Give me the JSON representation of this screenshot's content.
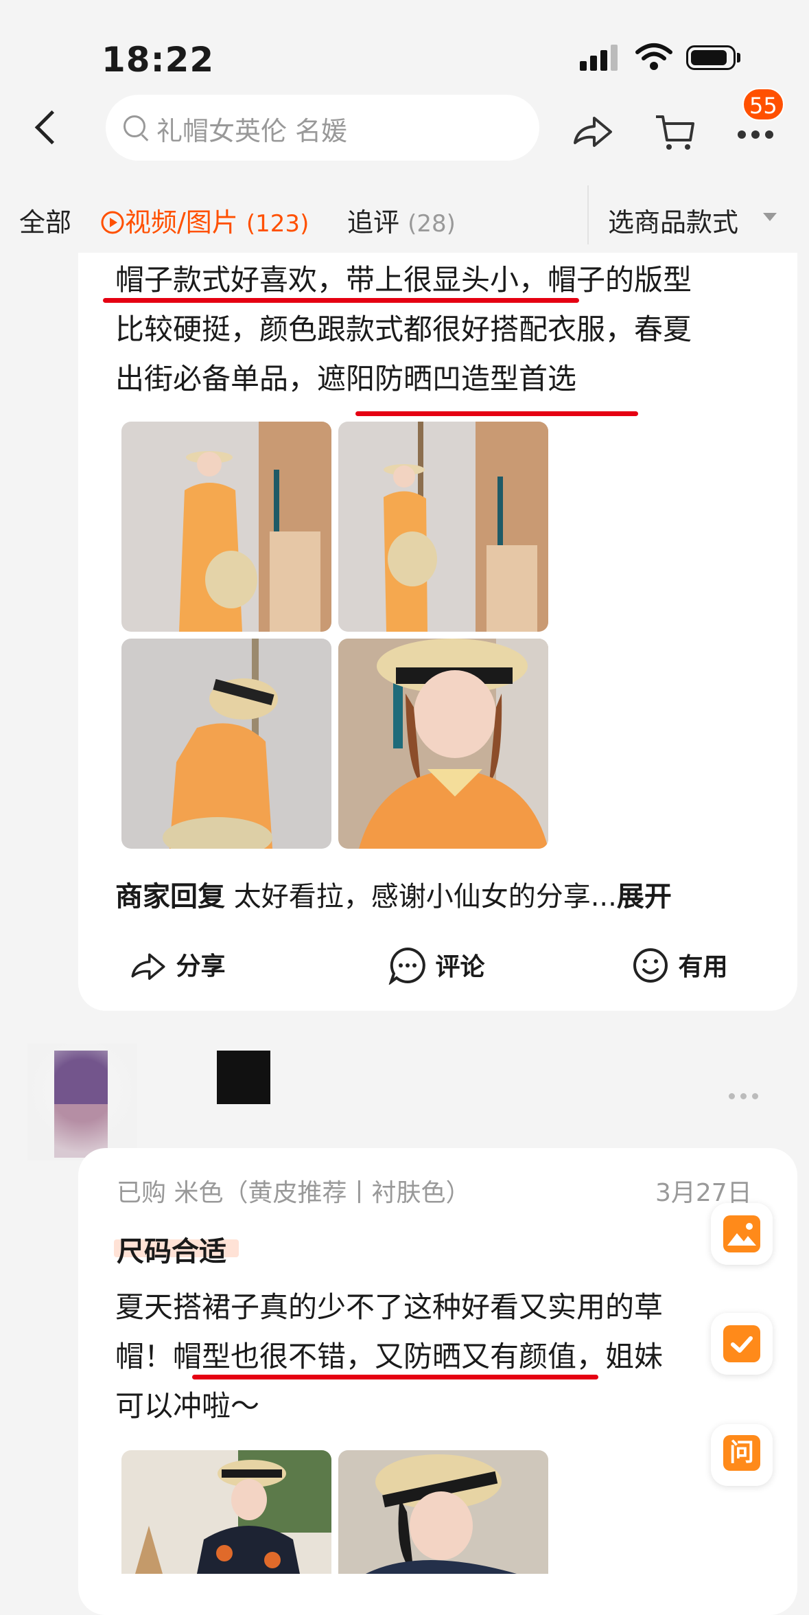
{
  "status": {
    "time": "18:22"
  },
  "header": {
    "search_placeholder": "礼帽女英伦 名媛",
    "cart_badge": "55"
  },
  "tabs": [
    {
      "label": "全部"
    },
    {
      "label": "视频/图片",
      "count": "(123)"
    },
    {
      "label": "追评",
      "count": "(28)"
    }
  ],
  "filter_label": "选商品款式",
  "review1": {
    "line1": "帽子款式好喜欢，带上很显头小，帽子的版型",
    "line2": "比较硬挺，颜色跟款式都很好搭配衣服，春夏",
    "line3": "出街必备单品，遮阳防晒凹造型首选",
    "seller_reply_label": "商家回复",
    "seller_reply_text": " 太好看拉，感谢小仙女的分享...",
    "expand": "展开",
    "actions": {
      "share": "分享",
      "comment": "评论",
      "useful": "有用"
    }
  },
  "review2": {
    "purchased": "已购 米色（黄皮推荐丨衬肤色）",
    "date": "3月27日",
    "tag": "尺码合适",
    "line1": "夏天搭裙子真的少不了这种好看又实用的草",
    "line2": "帽！帽型也很不错，又防晒又有颜值，姐妹",
    "line3": "可以冲啦～"
  },
  "float_buttons": {
    "ask": "问"
  },
  "colors": {
    "accent": "#ff5000",
    "underline": "#e50012"
  }
}
